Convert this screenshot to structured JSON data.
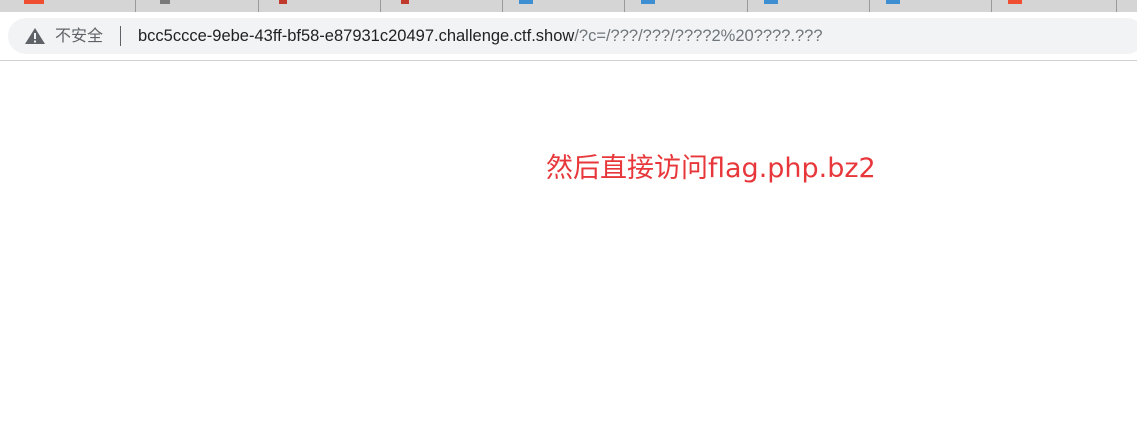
{
  "browser": {
    "tabs_count": 9,
    "address_bar": {
      "security_label": "不安全",
      "url_host": "bcc5ccce-9ebe-43ff-bf58-e87931c20497.challenge.ctf.show",
      "url_path": "/?c=/???/???/????2%20????.???"
    }
  },
  "page": {
    "message": "然后直接访问flag.php.bz2"
  },
  "colors": {
    "message_text": "#e8373a",
    "url_path": "#70757a",
    "url_host": "#202124"
  }
}
